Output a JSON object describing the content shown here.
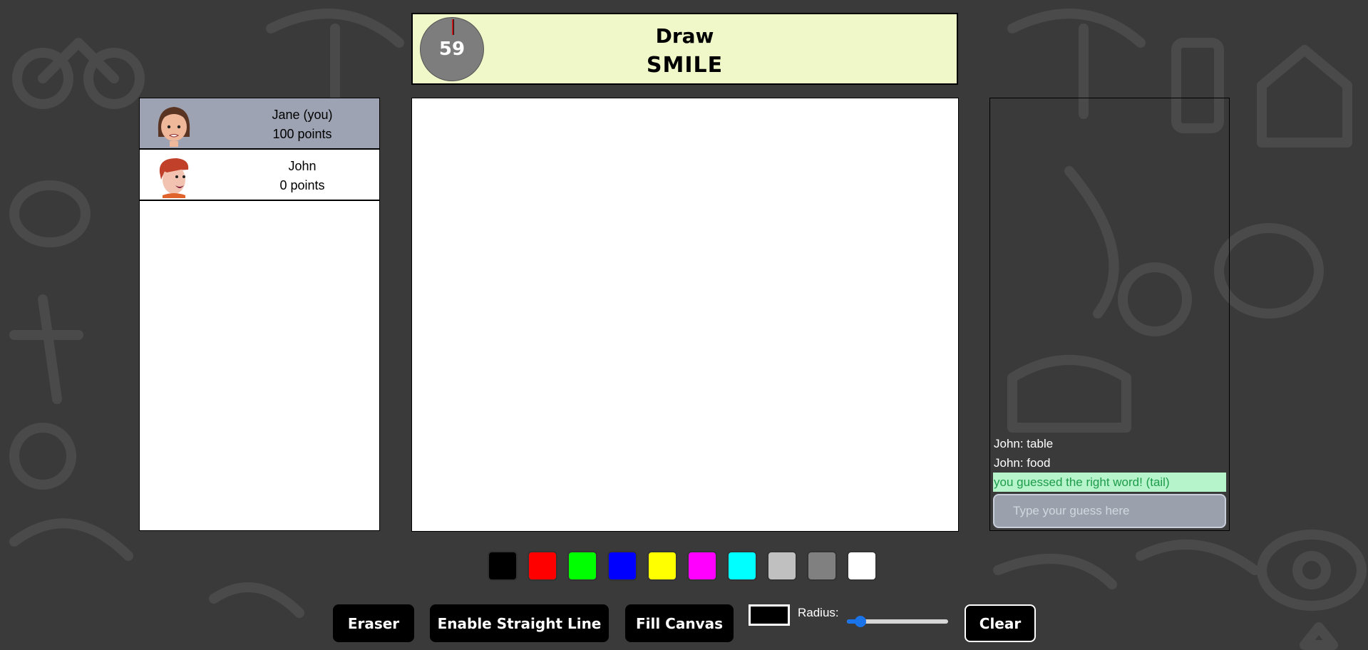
{
  "header": {
    "timer_value": "59",
    "mode": "Draw",
    "word": "SMILE"
  },
  "players": [
    {
      "name": "Jane (you)",
      "points": "100 points",
      "active": true
    },
    {
      "name": "John",
      "points": "0 points",
      "active": false
    }
  ],
  "chat": {
    "messages": [
      {
        "text": "John: table",
        "type": "normal"
      },
      {
        "text": "John: food",
        "type": "normal"
      },
      {
        "text": "you guessed the right word! (tail)",
        "type": "correct"
      }
    ],
    "input_placeholder": "Type your guess here"
  },
  "palette": {
    "colors": [
      "#000000",
      "#ff0000",
      "#00ff00",
      "#0000ff",
      "#ffff00",
      "#ff00ff",
      "#00ffff",
      "#c0c0c0",
      "#808080",
      "#ffffff"
    ]
  },
  "toolbar": {
    "eraser_label": "Eraser",
    "straight_line_label": "Enable Straight Line",
    "fill_label": "Fill Canvas",
    "radius_label": "Radius:",
    "radius_value_fraction": 0.08,
    "clear_label": "Clear",
    "current_color": "#000000"
  }
}
